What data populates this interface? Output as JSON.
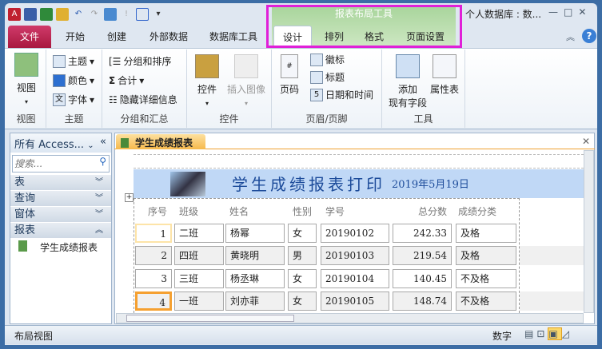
{
  "window": {
    "title": "个人数据库 : 数...",
    "minimize": "—",
    "maximize": "□",
    "close": "✕"
  },
  "quick_access": [
    "access-logo",
    "save",
    "excel",
    "design",
    "undo",
    "redo",
    "report",
    "exclamation",
    "table",
    "customize"
  ],
  "context": {
    "title": "报表布局工具"
  },
  "tabs": [
    {
      "label": "文件"
    },
    {
      "label": "开始"
    },
    {
      "label": "创建"
    },
    {
      "label": "外部数据"
    },
    {
      "label": "数据库工具"
    },
    {
      "label": "设计"
    },
    {
      "label": "排列"
    },
    {
      "label": "格式"
    },
    {
      "label": "页面设置"
    }
  ],
  "ribbon": {
    "view": {
      "button": "视图",
      "label": "视图"
    },
    "theme": {
      "items": [
        "主题",
        "颜色",
        "字体"
      ],
      "label": "主题"
    },
    "group": {
      "items": [
        "分组和排序",
        "合计",
        "隐藏详细信息"
      ],
      "label": "分组和汇总"
    },
    "controls": {
      "items": [
        "控件",
        "插入图像"
      ],
      "label": "控件"
    },
    "header": {
      "page": "页码",
      "items": [
        "徽标",
        "标题",
        "日期和时间"
      ],
      "label": "页眉/页脚"
    },
    "tools": {
      "add_field_1": "添加",
      "add_field_2": "现有字段",
      "props": "属性表",
      "label": "工具"
    }
  },
  "nav": {
    "title": "所有 Access...",
    "search_placeholder": "搜索...",
    "sections": [
      "表",
      "查询",
      "窗体",
      "报表"
    ],
    "items": [
      "学生成绩报表"
    ]
  },
  "document": {
    "tab": "学生成绩报表",
    "title": "学生成绩报表打印",
    "date": "2019年5月19日",
    "columns": [
      "序号",
      "班级",
      "姓名",
      "性别",
      "学号",
      "总分数",
      "成绩分类"
    ],
    "rows": [
      [
        "1",
        "二班",
        "杨幂",
        "女",
        "20190102",
        "242.33",
        "及格"
      ],
      [
        "2",
        "四班",
        "黄晓明",
        "男",
        "20190103",
        "219.54",
        "及格"
      ],
      [
        "3",
        "三班",
        "杨丞琳",
        "女",
        "20190104",
        "140.45",
        "不及格"
      ],
      [
        "4",
        "一班",
        "刘亦菲",
        "女",
        "20190105",
        "148.74",
        "不及格"
      ]
    ]
  },
  "status": {
    "left": "布局视图",
    "mode": "数字"
  },
  "colors": {
    "file_tab": "#b8204a",
    "context": "#a7d49a",
    "highlight": "#e020d8",
    "band": "#c0d8f6"
  }
}
